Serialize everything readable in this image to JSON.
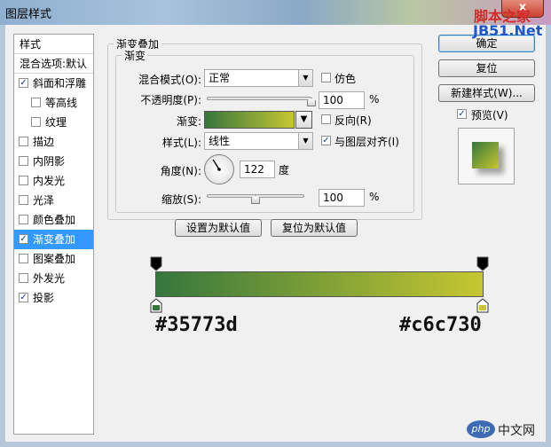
{
  "window": {
    "title": "图层样式",
    "close_label": "x"
  },
  "watermark": {
    "line1": "脚本之家",
    "line2": "JB51.Net",
    "logo_text": "php",
    "site": "中文网"
  },
  "style_list": {
    "header_styles": "样式",
    "header_blend": "混合选项:默认",
    "items": [
      {
        "label": "斜面和浮雕",
        "checked": true
      },
      {
        "label": "等高线",
        "checked": false
      },
      {
        "label": "纹理",
        "checked": false
      },
      {
        "label": "描边",
        "checked": false
      },
      {
        "label": "内阴影",
        "checked": false
      },
      {
        "label": "内发光",
        "checked": false
      },
      {
        "label": "光泽",
        "checked": false
      },
      {
        "label": "颜色叠加",
        "checked": false
      },
      {
        "label": "渐变叠加",
        "checked": true
      },
      {
        "label": "图案叠加",
        "checked": false
      },
      {
        "label": "外发光",
        "checked": false
      },
      {
        "label": "投影",
        "checked": true
      }
    ]
  },
  "gradient_overlay": {
    "group_title": "渐变叠加",
    "sub_title": "渐变",
    "blend_mode_label": "混合模式(O):",
    "blend_mode_value": "正常",
    "dither_label": "仿色",
    "opacity_label": "不透明度(P):",
    "opacity_value": "100",
    "opacity_percent": 100,
    "gradient_label": "渐变:",
    "reverse_label": "反向(R)",
    "style_label": "样式(L):",
    "style_value": "线性",
    "align_label": "与图层对齐(I)",
    "angle_label": "角度(N):",
    "angle_value": "122",
    "angle_unit": "度",
    "scale_label": "缩放(S):",
    "scale_value": "100",
    "scale_slider": 0.5,
    "percent": "%",
    "make_default": "设置为默认值",
    "reset_default": "复位为默认值"
  },
  "buttons": {
    "ok": "确定",
    "reset": "复位",
    "new_style": "新建样式(W)...",
    "preview": "预览(V)"
  },
  "gradient_editor": {
    "start_color": "#35773d",
    "end_color": "#c6c730",
    "start_label": "#35773d",
    "end_label": "#c6c730"
  },
  "colors": {
    "selection": "#3399ff",
    "checkmark": "#1c3d8f"
  }
}
